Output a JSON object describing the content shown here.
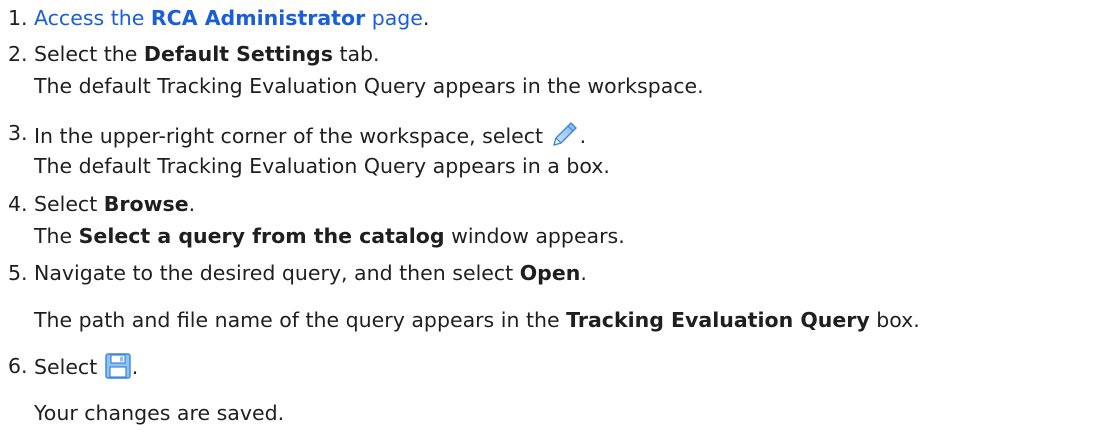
{
  "steps": [
    {
      "number": "1.",
      "link_prefix": "Access the ",
      "link_bold": "RCA Administrator",
      "link_suffix": " page",
      "tail": "."
    },
    {
      "number": "2.",
      "prefix": "Select the ",
      "bold": "Default Settings",
      "suffix": " tab.",
      "result": "The default Tracking Evaluation Query appears in the workspace."
    },
    {
      "number": "3.",
      "prefix": "In the upper-right corner of the workspace, select ",
      "icon": "pencil-icon",
      "suffix": ".",
      "result": "The default Tracking Evaluation Query appears in a box."
    },
    {
      "number": "4.",
      "prefix": "Select ",
      "bold": "Browse",
      "suffix": ".",
      "result_prefix": "The ",
      "result_bold": "Select a query from the catalog",
      "result_suffix": " window appears."
    },
    {
      "number": "5.",
      "prefix": "Navigate to the desired query, and then select ",
      "bold": "Open",
      "suffix": ".",
      "result_prefix": "The path and file name of the query appears in the ",
      "result_bold": "Tracking Evaluation Query",
      "result_suffix": " box."
    },
    {
      "number": "6.",
      "prefix": "Select ",
      "icon": "save-icon",
      "suffix": ".",
      "result": "Your changes are saved."
    }
  ],
  "colors": {
    "text": "#1f1f1f",
    "link": "#1a5fd8",
    "icon_blue": "#4a9be0"
  }
}
